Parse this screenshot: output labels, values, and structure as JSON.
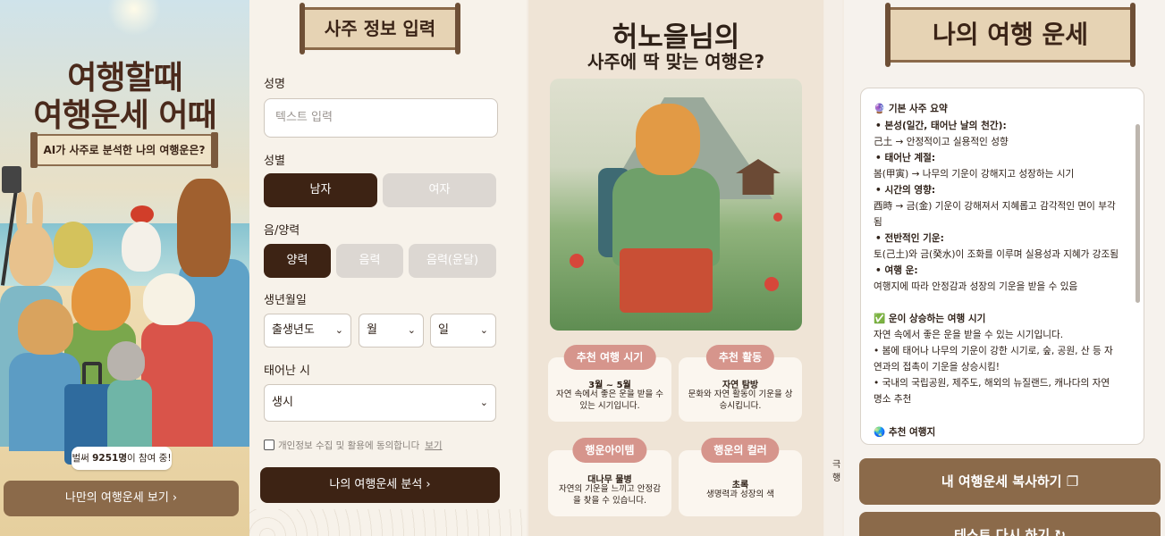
{
  "panel1": {
    "title_line1": "여행할때",
    "title_line2": "여행운세 어때",
    "banner": "AI가 사주로 분석한 나의 여행운은?",
    "badge_prefix": "벌써 ",
    "badge_count": "9251명",
    "badge_suffix": "이 참여 중!",
    "cta": "나만의 여행운세 보기 ›"
  },
  "panel2": {
    "header": "사주 정보 입력",
    "name_label": "성명",
    "name_placeholder": "텍스트 입력",
    "gender_label": "성별",
    "gender_male": "남자",
    "gender_female": "여자",
    "calendar_label": "음/양력",
    "cal_solar": "양력",
    "cal_lunar": "음력",
    "cal_lunar_leap": "음력(윤달)",
    "birth_label": "생년월일",
    "year_select": "출생년도",
    "month_select": "월",
    "day_select": "일",
    "time_label": "태어난 시",
    "time_select": "생시",
    "agree_text": "개인정보 수집 및 활용에 동의합니다",
    "agree_link": "보기",
    "submit": "나의 여행운세 분석 ›"
  },
  "panel3": {
    "title": "허노을님의",
    "subtitle": "사주에 딱 맞는 여행은?",
    "cards": [
      {
        "tag": "추천 여행 시기",
        "head": "3월 ~ 5월",
        "desc": "자연 속에서 좋은 운을 받을 수 있는 시기입니다."
      },
      {
        "tag": "추천 활동",
        "head": "자연 탐방",
        "desc": "문화와 자연 활동이 기운을 상승시킵니다."
      },
      {
        "tag": "행운아이템",
        "head": "대나무 물병",
        "desc": "자연의 기운을 느끼고 안정감을 찾을 수 있습니다."
      },
      {
        "tag": "행운의 컬러",
        "head": "초록",
        "desc": "생명력과 성장의 색"
      }
    ]
  },
  "strip": {
    "a": "극",
    "b": "행"
  },
  "panel5": {
    "header": "나의 여행 운세",
    "lines": [
      {
        "t": "🔮 기본 사주 요약",
        "style": "b"
      },
      {
        "t": "•  본성(일간, 태어난 날의 천간):",
        "style": "b"
      },
      {
        "t": "己土 → 안정적이고 실용적인 성향",
        "style": ""
      },
      {
        "t": "•  태어난 계절:",
        "style": "b"
      },
      {
        "t": "봄(甲寅) → 나무의 기운이 강해지고 성장하는 시기",
        "style": ""
      },
      {
        "t": "•  시간의 영향:",
        "style": "b"
      },
      {
        "t": "酉時 → 금(金) 기운이 강해져서 지혜롭고 감각적인 면이 부각",
        "style": ""
      },
      {
        "t": "됨",
        "style": ""
      },
      {
        "t": "•  전반적인 기운:",
        "style": "b"
      },
      {
        "t": "토(己土)와 금(癸水)이 조화를 이루며 실용성과 지혜가 강조됨",
        "style": ""
      },
      {
        "t": "•  여행 운:",
        "style": "b"
      },
      {
        "t": "여행지에 따라 안정감과 성장의 기운을 받을 수 있음",
        "style": ""
      },
      {
        "t": "✅ 운이 상승하는 여행 시기",
        "style": "b"
      },
      {
        "t": "자연 속에서 좋은 운을 받을 수 있는 시기입니다.",
        "style": ""
      },
      {
        "t": "•  봄에 태어나 나무의 기운이 강한 시기로, 숲, 공원, 산 등 자",
        "style": ""
      },
      {
        "t": "연과의 접촉이 기운을 상승시킴!",
        "style": ""
      },
      {
        "t": "•  국내의 국립공원, 제주도, 해외의 뉴질랜드, 캐나다의 자연",
        "style": ""
      },
      {
        "t": "명소 추천",
        "style": ""
      },
      {
        "t": "🌏 추천 여행지",
        "style": "b"
      }
    ],
    "copy_btn": "내 여행운세 복사하기 ❐",
    "retry_btn": "테스트 다시 하기 ↻"
  }
}
